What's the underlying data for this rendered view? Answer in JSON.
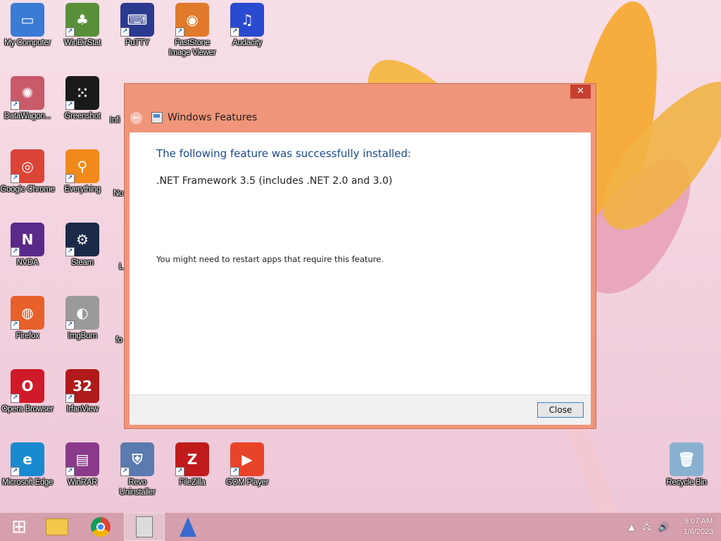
{
  "desktop": {
    "icons": [
      {
        "id": "my-computer",
        "label": "My Computer",
        "glyph": "▭",
        "color": "#3a7bd5"
      },
      {
        "id": "windirstat",
        "label": "WinDirStat",
        "glyph": "♣",
        "color": "#5a8f3a"
      },
      {
        "id": "putty",
        "label": "PuTTY",
        "glyph": "⌨",
        "color": "#2a3a8f"
      },
      {
        "id": "faststone",
        "label": "FastStone Image Viewer",
        "glyph": "◉",
        "color": "#e07a2a"
      },
      {
        "id": "audacity",
        "label": "Audacity",
        "glyph": "♫",
        "color": "#2a4ad0"
      },
      {
        "id": "datawagon",
        "label": "DataWagon...",
        "glyph": "✺",
        "color": "#c85a6a"
      },
      {
        "id": "greenshot",
        "label": "Greenshot",
        "glyph": "⁙",
        "color": "#1a1a1a"
      },
      {
        "id": "chrome",
        "label": "Google Chrome",
        "glyph": "◎",
        "color": "#db4437"
      },
      {
        "id": "everything",
        "label": "Everything",
        "glyph": "⚲",
        "color": "#f08a1a"
      },
      {
        "id": "nvda",
        "label": "NVDA",
        "glyph": "N",
        "color": "#5a2a8a"
      },
      {
        "id": "steam",
        "label": "Steam",
        "glyph": "⚙",
        "color": "#1b2a48"
      },
      {
        "id": "firefox",
        "label": "Firefox",
        "glyph": "◍",
        "color": "#e8602a"
      },
      {
        "id": "imgburn",
        "label": "ImgBurn",
        "glyph": "◐",
        "color": "#9a9a9a"
      },
      {
        "id": "opera",
        "label": "Opera Browser",
        "glyph": "O",
        "color": "#d01a2a"
      },
      {
        "id": "irfanview",
        "label": "IrfanView",
        "glyph": "32",
        "color": "#b01a1a"
      },
      {
        "id": "edge",
        "label": "Microsoft Edge",
        "glyph": "e",
        "color": "#1a8ad0"
      },
      {
        "id": "winrar",
        "label": "WinRAR",
        "glyph": "▤",
        "color": "#8a3a8a"
      },
      {
        "id": "revo",
        "label": "Revo Uninstaller",
        "glyph": "⛨",
        "color": "#5a7ab0"
      },
      {
        "id": "filezilla",
        "label": "FileZilla",
        "glyph": "Z",
        "color": "#c01a1a"
      },
      {
        "id": "gom",
        "label": "GOM Player",
        "glyph": "▶",
        "color": "#e8442a"
      },
      {
        "id": "recycle",
        "label": "Recycle Bin",
        "glyph": "🗑",
        "color": "#8ab0d0"
      }
    ],
    "partial_labels": [
      "Infi",
      "No",
      "L",
      "fo"
    ]
  },
  "dialog": {
    "title": "Windows Features",
    "heading": "The following feature was successfully installed:",
    "feature": ".NET Framework 3.5 (includes .NET 2.0 and 3.0)",
    "note": "You might need to restart apps that require this feature.",
    "close_button": "Close",
    "close_x": "✕",
    "back_glyph": "←"
  },
  "taskbar": {
    "start_glyph": "⊞",
    "clock_time": "9:07 AM",
    "clock_date": "1/6/2023",
    "tray_icons": [
      "▲",
      "🖧",
      "🔊"
    ]
  }
}
